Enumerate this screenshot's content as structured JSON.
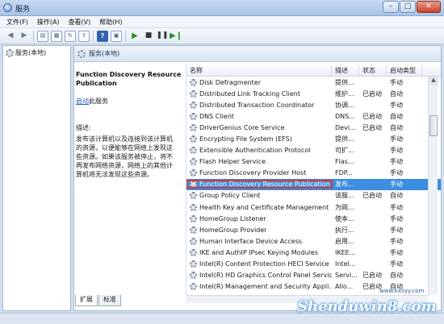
{
  "window": {
    "title": "服务"
  },
  "menu": [
    "文件(F)",
    "操作(A)",
    "查看(V)",
    "帮助(H)"
  ],
  "tree": {
    "root_label": "服务(本地)"
  },
  "header": {
    "title": "服务(本地)"
  },
  "detail": {
    "service_name": "Function Discovery Resource Publication",
    "start_link": "启动",
    "start_suffix": "此服务",
    "desc_label": "描述:",
    "desc_text": "发布该计算机以及连接到该计算机的资源，以便能够在网络上发现这些资源。如果该服务被停止，将不再发布网络资源，网络上的其他计算机将无法发现这些资源。"
  },
  "columns": {
    "name": "名称",
    "desc": "描述",
    "status": "状态",
    "startup": "启动类型"
  },
  "services": [
    {
      "name": "Disk Defragmenter",
      "desc": "提供...",
      "status": "",
      "startup": "手动"
    },
    {
      "name": "Distributed Link Tracking Client",
      "desc": "维护...",
      "status": "已启动",
      "startup": "自动"
    },
    {
      "name": "Distributed Transaction Coordinator",
      "desc": "协调...",
      "status": "",
      "startup": "手动"
    },
    {
      "name": "DNS Client",
      "desc": "DNS...",
      "status": "已启动",
      "startup": "自动"
    },
    {
      "name": "DriverGenius Core Service",
      "desc": "Devi...",
      "status": "已启动",
      "startup": "自动"
    },
    {
      "name": "Encrypting File System (EFS)",
      "desc": "提供...",
      "status": "",
      "startup": "手动"
    },
    {
      "name": "Extensible Authentication Protocol",
      "desc": "可扩...",
      "status": "",
      "startup": "手动"
    },
    {
      "name": "Flash Helper Service",
      "desc": "Flas...",
      "status": "",
      "startup": "手动"
    },
    {
      "name": "Function Discovery Provider Host",
      "desc": "FDP...",
      "status": "",
      "startup": "手动"
    },
    {
      "name": "Function Discovery Resource Publication",
      "desc": "发布...",
      "status": "",
      "startup": "手动",
      "selected": true
    },
    {
      "name": "Group Policy Client",
      "desc": "该服...",
      "status": "已启动",
      "startup": "自动"
    },
    {
      "name": "Health Key and Certificate Management",
      "desc": "为网...",
      "status": "",
      "startup": "手动"
    },
    {
      "name": "HomeGroup Listener",
      "desc": "使本...",
      "status": "",
      "startup": "手动"
    },
    {
      "name": "HomeGroup Provider",
      "desc": "执行...",
      "status": "",
      "startup": "手动"
    },
    {
      "name": "Human Interface Device Access",
      "desc": "启用...",
      "status": "",
      "startup": "手动"
    },
    {
      "name": "IKE and AuthIP IPsec Keying Modules",
      "desc": "IKEE...",
      "status": "",
      "startup": "手动"
    },
    {
      "name": "Intel(R) Content Protection HECI Service",
      "desc": "Intel...",
      "status": "",
      "startup": "手动"
    },
    {
      "name": "Intel(R) HD Graphics Control Panel Service",
      "desc": "Servi...",
      "status": "已启动",
      "startup": "自动"
    },
    {
      "name": "Intel(R) Management and Security Appli...",
      "desc": "Allo...",
      "status": "已启动",
      "startup": "自动"
    }
  ],
  "tabs": [
    "扩展",
    "标准"
  ],
  "watermark": {
    "text": "Shenduwin8.com",
    "sub": "www.kxiiyy.com"
  }
}
